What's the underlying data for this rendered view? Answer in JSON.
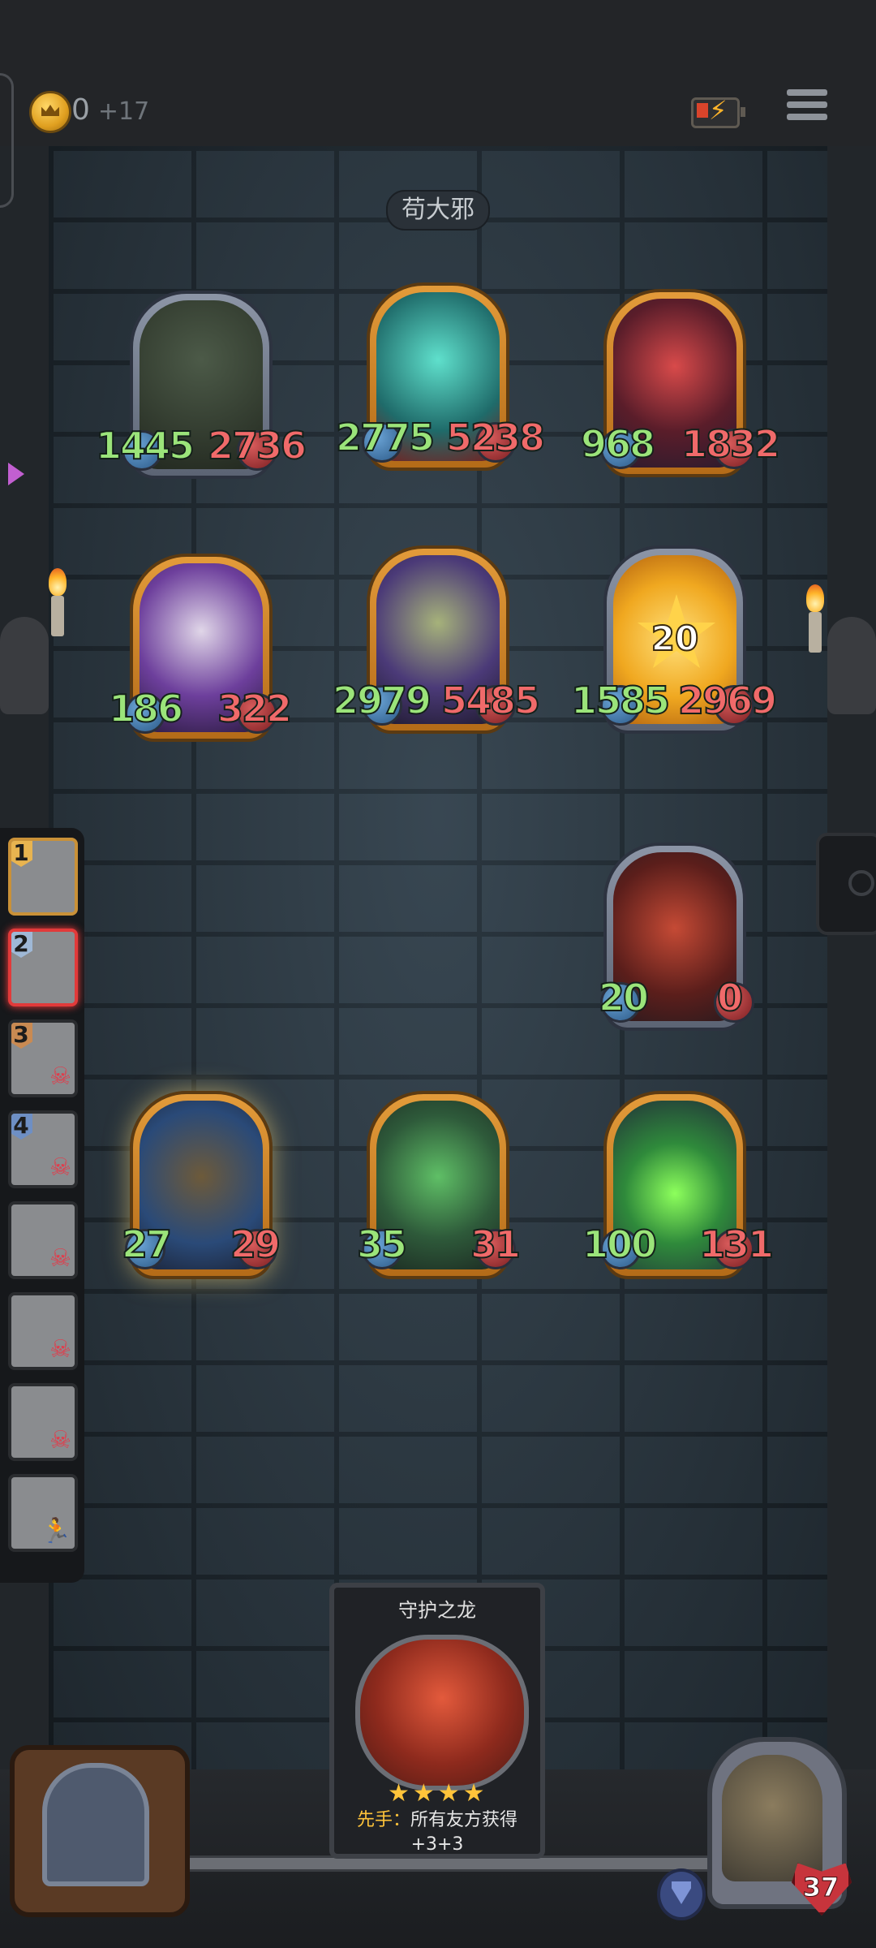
{
  "topbar": {
    "gold_value": "0",
    "gold_income": "+17",
    "icons": [
      "crown-coin-icon",
      "battery-charging-icon",
      "menu-icon"
    ]
  },
  "board": {
    "enemy_name": "苟大邪",
    "enemy_units": [
      {
        "name": "hooded-necromancer",
        "atk": "1445",
        "hp": "2736",
        "frame": "silver"
      },
      {
        "name": "spectral-ghost",
        "atk": "2775",
        "hp": "5238",
        "frame": "gold"
      },
      {
        "name": "jester-clown",
        "atk": "968",
        "hp": "1832",
        "frame": "gold"
      },
      {
        "name": "skeletal-dragon",
        "atk": "186",
        "hp": "322",
        "frame": "gold"
      },
      {
        "name": "horned-dragon",
        "atk": "2979",
        "hp": "5485",
        "frame": "gold"
      },
      {
        "name": "golden-star-flame",
        "atk": "1585",
        "hp": "2969",
        "frame": "silver",
        "badge": "20"
      }
    ],
    "player_units": [
      {
        "name": "red-dragon",
        "atk": "20",
        "hp": "0",
        "frame": "silver"
      },
      {
        "name": "armored-knight",
        "atk": "27",
        "hp": "29",
        "frame": "gold"
      },
      {
        "name": "green-frog-dragon",
        "atk": "35",
        "hp": "31",
        "frame": "gold"
      },
      {
        "name": "toxic-green-dragon",
        "atk": "100",
        "hp": "131",
        "frame": "gold"
      }
    ]
  },
  "sidebar": {
    "slots": [
      {
        "rank": "1",
        "state": "first"
      },
      {
        "rank": "2",
        "state": "active"
      },
      {
        "rank": "3",
        "state": "dead"
      },
      {
        "rank": "4",
        "state": "dead"
      },
      {
        "rank": "",
        "state": "dead"
      },
      {
        "rank": "",
        "state": "dead"
      },
      {
        "rank": "",
        "state": "dead"
      },
      {
        "rank": "",
        "state": "dead"
      }
    ]
  },
  "hand_card": {
    "title": "守护之龙",
    "stars": "★★★★",
    "keyword": "先手：",
    "description": "所有友方获得",
    "bonus": "+3+3"
  },
  "player": {
    "lives": "37"
  },
  "colors": {
    "atk": "#9be47a",
    "hp": "#f06a6a",
    "gold_frame": "#e39b3a",
    "silver_frame": "#8c95a6"
  }
}
